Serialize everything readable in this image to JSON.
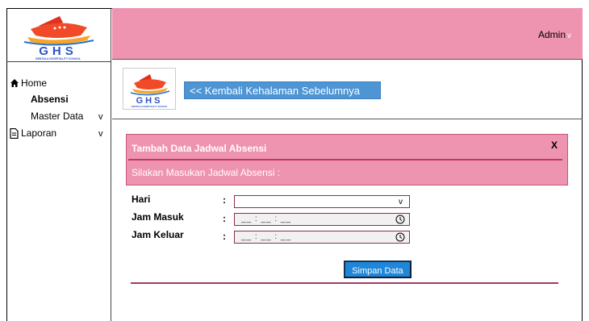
{
  "logo": {
    "text": "GHS",
    "subtitle": "GENTALA HOSPITALITY SCHOOL"
  },
  "header": {
    "user_label": "Admin",
    "user_caret": "v"
  },
  "sidebar": {
    "items": [
      {
        "label": "Home",
        "icon": "home-icon"
      },
      {
        "label": "Absensi"
      },
      {
        "label": "Master Data",
        "caret": "v"
      },
      {
        "label": "Laporan",
        "icon": "document-icon",
        "caret": "v"
      }
    ]
  },
  "back_button": {
    "label": "<< Kembali Kehalaman Sebelumnya"
  },
  "form": {
    "title": "Tambah Data Jadwal Absensi",
    "close": "X",
    "subtitle": "Silakan Masukan Jadwal Absensi :",
    "fields": [
      {
        "label": "Hari",
        "colon": ":",
        "value": "",
        "caret": "v"
      },
      {
        "label": "Jam Masuk",
        "colon": ":",
        "placeholder": "__ : __ : __"
      },
      {
        "label": "Jam Keluar",
        "colon": ":",
        "placeholder": "__ : __ : __"
      }
    ],
    "save_label": "Simpan Data"
  },
  "colors": {
    "accent_pink": "#ee93b0",
    "button_blue": "#4d95d4",
    "line_maroon": "#a33a62"
  }
}
